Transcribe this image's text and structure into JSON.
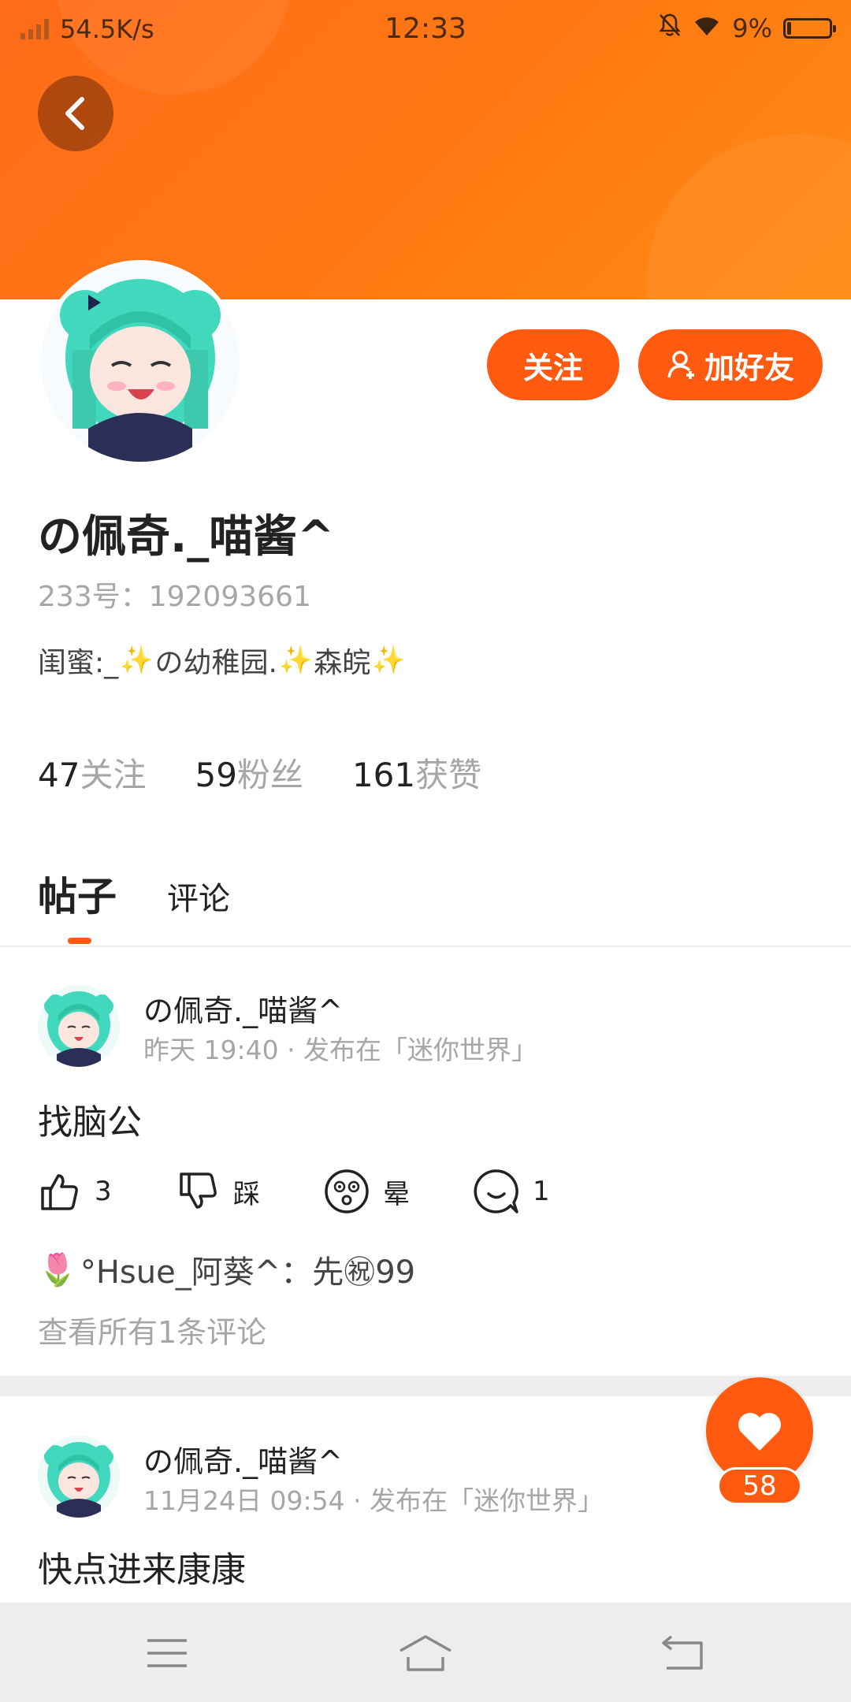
{
  "status_bar": {
    "network_speed": "54.5K/s",
    "time": "12:33",
    "battery": "9%",
    "icons": [
      "signal-icon",
      "bell-muted-icon",
      "wifi-icon",
      "battery-icon"
    ]
  },
  "profile": {
    "username": "の佩奇._喵酱^",
    "id_text": "233号：192093661",
    "bio_parts": [
      "闺蜜:_",
      "の幼稚园.",
      "森皖"
    ],
    "follow_button": "关注",
    "add_friend_button": "加好友",
    "stats": [
      {
        "num": "47",
        "label": "关注"
      },
      {
        "num": "59",
        "label": "粉丝"
      },
      {
        "num": "161",
        "label": "获赞"
      }
    ]
  },
  "tabs": [
    {
      "label": "帖子",
      "active": true
    },
    {
      "label": "评论",
      "active": false
    }
  ],
  "posts": [
    {
      "author": "の佩奇._喵酱^",
      "meta": "昨天 19:40 · 发布在「迷你世界」",
      "content": "找脑公",
      "actions": [
        {
          "icon": "thumbs-up-icon",
          "label": "3"
        },
        {
          "icon": "thumbs-down-icon",
          "label": "踩"
        },
        {
          "icon": "dizzy-face-icon",
          "label": "晕"
        },
        {
          "icon": "comment-icon",
          "label": "1"
        }
      ],
      "comment": {
        "emoji": "🌷",
        "text": "°Hsue_阿葵^：先㊗99"
      },
      "view_all": "查看所有1条评论"
    },
    {
      "author": "の佩奇._喵酱^",
      "meta": "11月24日 09:54 · 发布在「迷你世界」",
      "content": "快点进来康康"
    }
  ],
  "like_fab": {
    "count": "58"
  },
  "colors": {
    "accent": "#ff5a10",
    "header": "#ff7a12",
    "muted": "#a6a6a6"
  }
}
